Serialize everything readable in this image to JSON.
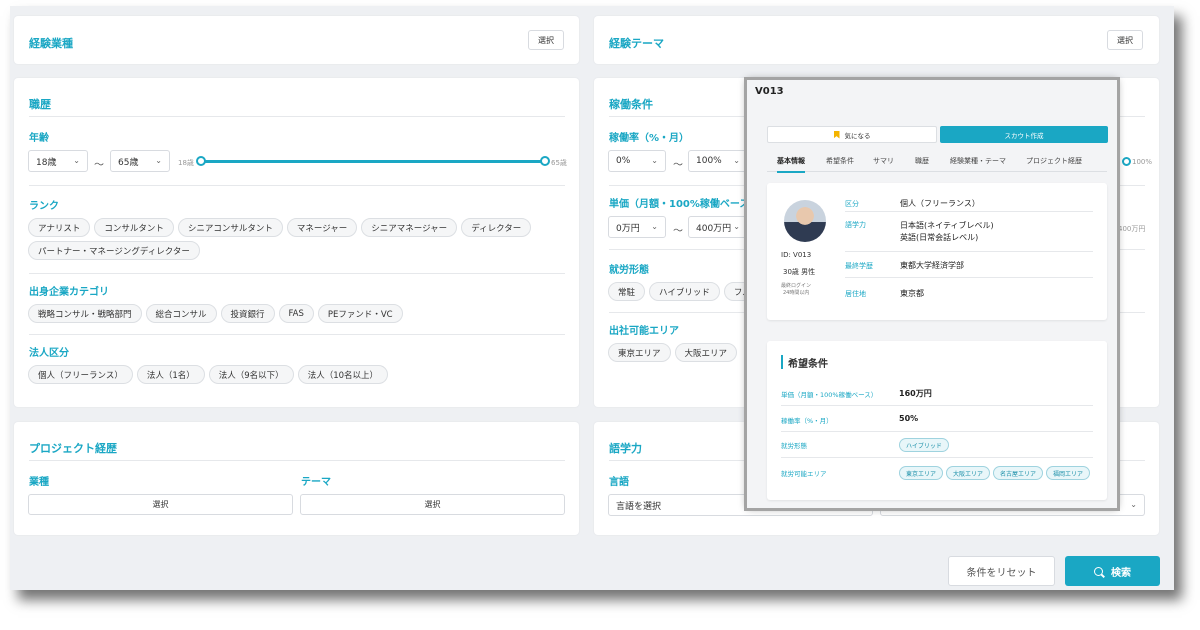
{
  "experience_industry": {
    "title": "経験業種",
    "select_label": "選択"
  },
  "experience_theme": {
    "title": "経験テーマ",
    "select_label": "選択"
  },
  "career": {
    "title": "職歴",
    "age": {
      "label": "年齢",
      "from": "18歳",
      "to": "65歳",
      "tilde": "〜",
      "slider_min": "18歳",
      "slider_max": "65歳"
    },
    "rank": {
      "label": "ランク",
      "chips": [
        "アナリスト",
        "コンサルタント",
        "シニアコンサルタント",
        "マネージャー",
        "シニアマネージャー",
        "ディレクター",
        "パートナー・マネージングディレクター"
      ]
    },
    "origin": {
      "label": "出身企業カテゴリ",
      "chips": [
        "戦略コンサル・戦略部門",
        "総合コンサル",
        "投資銀行",
        "FAS",
        "PEファンド・VC"
      ]
    },
    "corp": {
      "label": "法人区分",
      "chips": [
        "個人（フリーランス）",
        "法人（1名）",
        "法人（9名以下）",
        "法人（10名以上）"
      ]
    }
  },
  "work": {
    "title": "稼働条件",
    "rate": {
      "label": "稼働率（%・月）",
      "from": "0%",
      "to": "100%",
      "tilde": "〜",
      "slider_max": "100%"
    },
    "price": {
      "label": "単価（月額・100%稼働ベース）",
      "from": "0万円",
      "to": "400万円",
      "tilde": "〜",
      "slider_max": "400万円"
    },
    "style": {
      "label": "就労形態",
      "chips": [
        "常駐",
        "ハイブリッド",
        "フル"
      ]
    },
    "area": {
      "label": "出社可能エリア",
      "chips": [
        "東京エリア",
        "大阪エリア"
      ]
    }
  },
  "project": {
    "title": "プロジェクト経歴",
    "industry_label": "業種",
    "theme_label": "テーマ",
    "industry_select": "選択",
    "theme_select": "選択"
  },
  "language": {
    "title": "語学力",
    "lang_label": "言語",
    "lang_placeholder": "言語を選択"
  },
  "actions": {
    "reset": "条件をリセット",
    "search": "検索"
  },
  "profile": {
    "id": "V013",
    "fav_label": "気になる",
    "scout_label": "スカウト作成",
    "tabs": [
      "基本情報",
      "希望条件",
      "サマリ",
      "職歴",
      "経験業種・テーマ",
      "プロジェクト経歴"
    ],
    "id_line": "ID: V013",
    "age_gender": "30歳 男性",
    "last_login_1": "最終ログイン",
    "last_login_2": "24時間以内",
    "basic": {
      "k1": "区分",
      "v1": "個人（フリーランス）",
      "k2": "語学力",
      "v2a": "日本語(ネイティブレベル)",
      "v2b": "英語(日常会話レベル)",
      "k3": "最終学歴",
      "v3": "東都大学経済学部",
      "k4": "居住地",
      "v4": "東京都"
    },
    "pref": {
      "title": "希望条件",
      "k1": "単価（月額・100%稼働ベース）",
      "v1": "160万円",
      "k2": "稼働率（%・月）",
      "v2": "50%",
      "k3": "就労形態",
      "tags3": [
        "ハイブリッド"
      ],
      "k4": "就労可能エリア",
      "tags4": [
        "東京エリア",
        "大阪エリア",
        "名古屋エリア",
        "福岡エリア"
      ]
    }
  },
  "colors": {
    "accent": "#1aa7c4",
    "bookmark": "#f4b400"
  }
}
